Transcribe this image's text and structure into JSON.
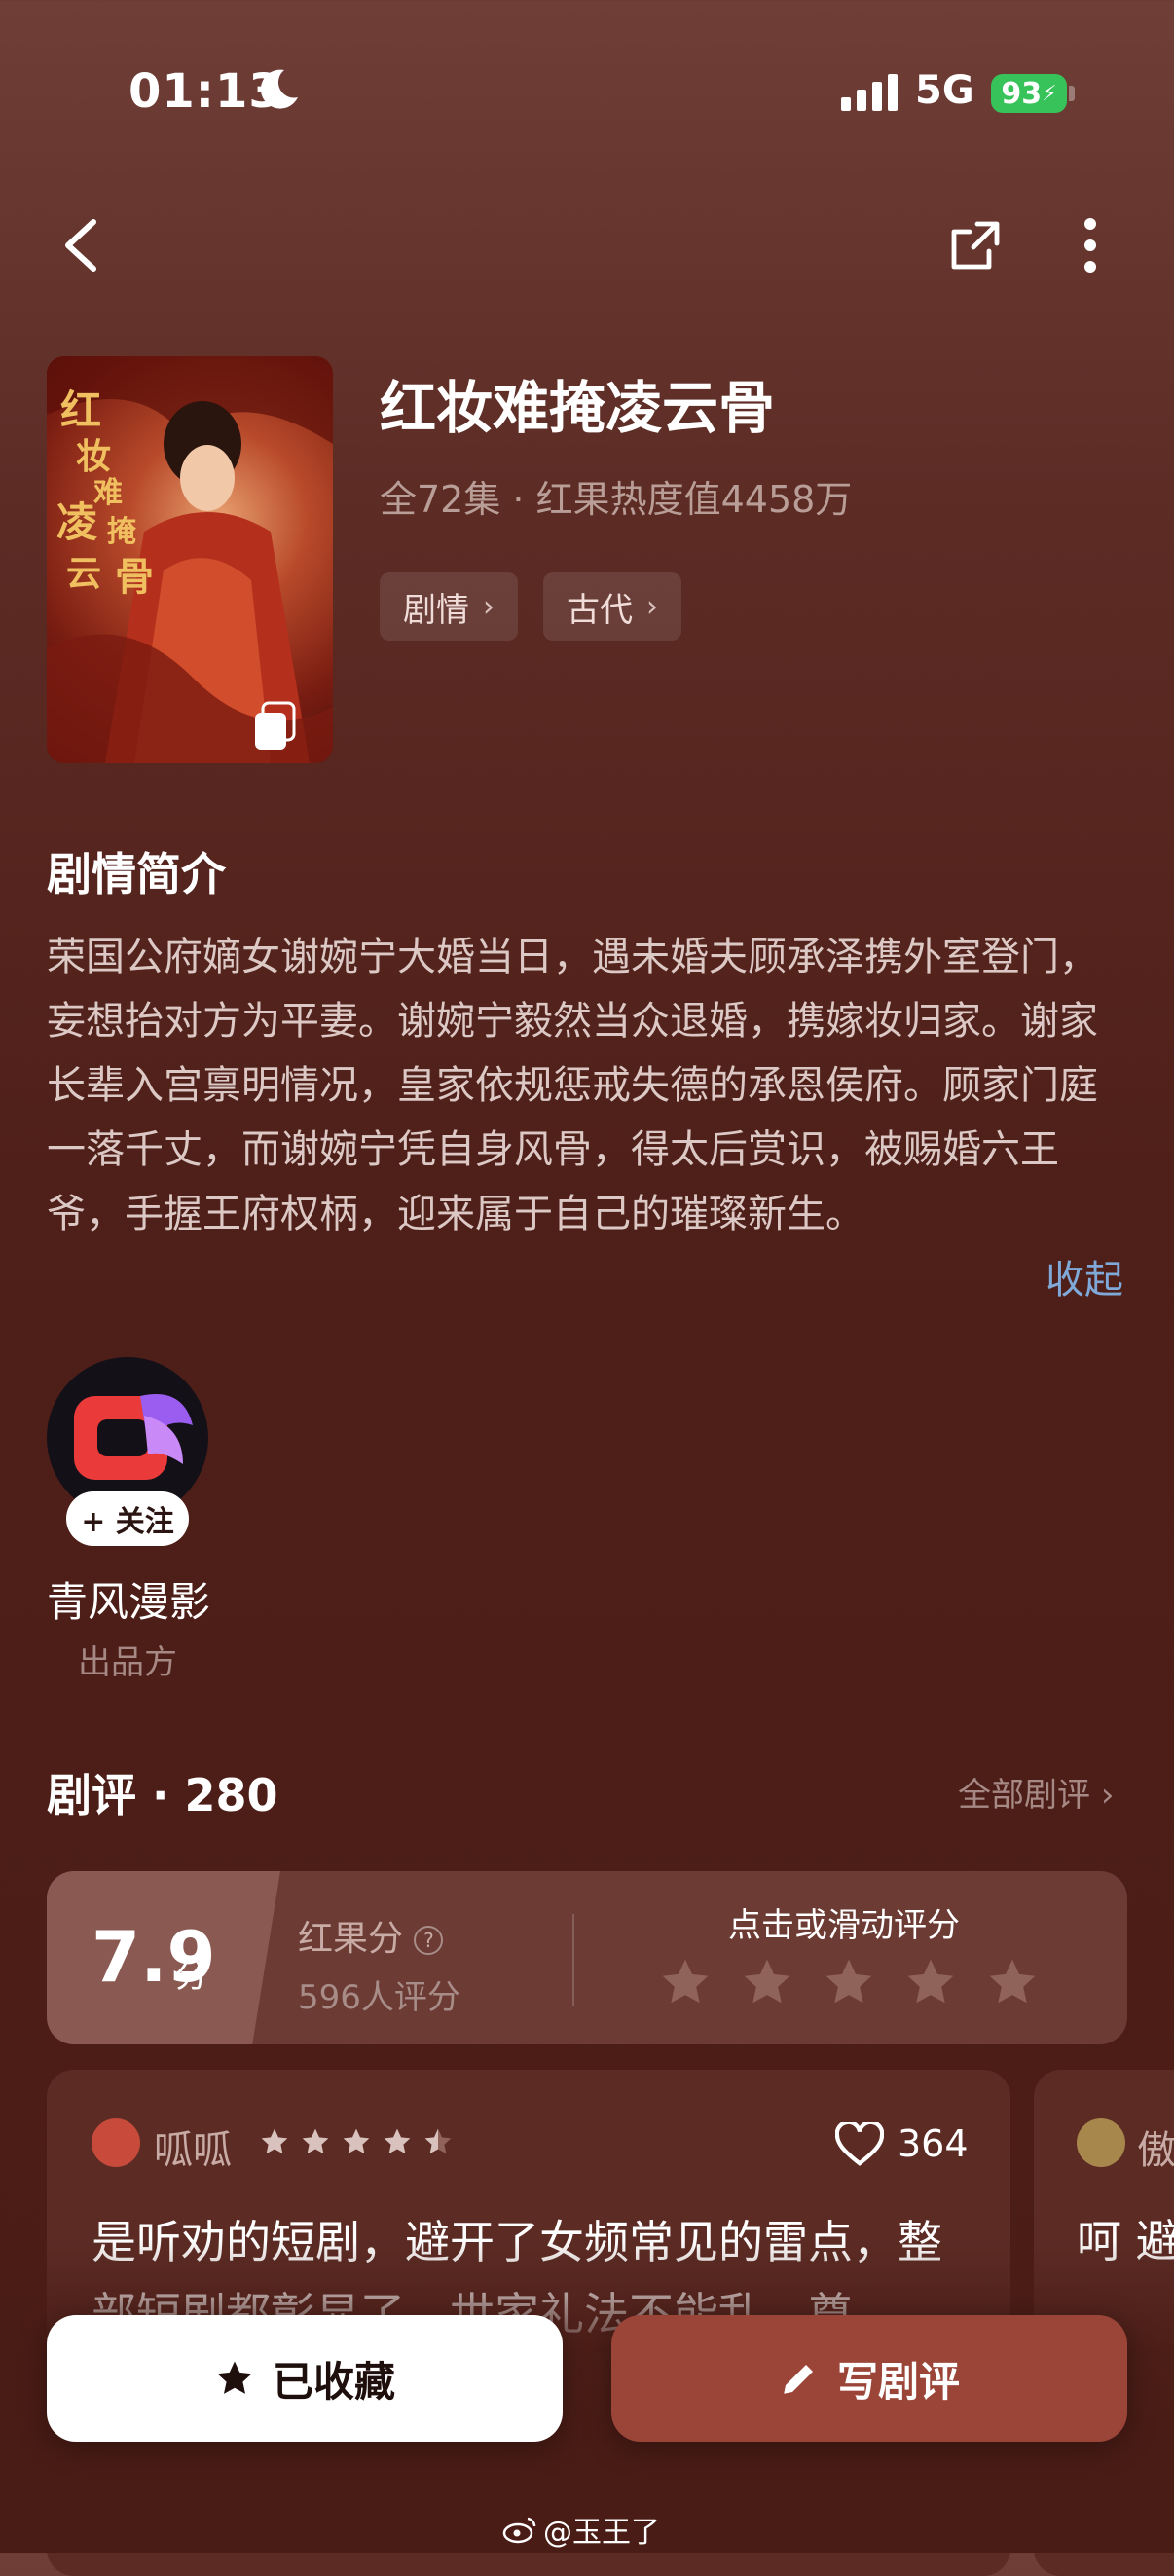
{
  "status": {
    "time": "01:13",
    "network": "5G",
    "battery": "93"
  },
  "drama": {
    "title": "红妆难掩凌云骨",
    "meta": "全72集 · 红果热度值4458万",
    "tags": [
      "剧情",
      "古代"
    ],
    "poster_title": "红妆难掩凌云骨"
  },
  "synopsis": {
    "heading": "剧情简介",
    "text": "荣国公府嫡女谢婉宁大婚当日，遇未婚夫顾承泽携外室登门，妄想抬对方为平妻。谢婉宁毅然当众退婚，携嫁妆归家。谢家长辈入宫禀明情况，皇家依规惩戒失德的承恩侯府。顾家门庭一落千丈，而谢婉宁凭自身风骨，得太后赏识，被赐婚六王爷，手握王府权柄，迎来属于自己的璀璨新生。",
    "collapse_label": "收起"
  },
  "publisher": {
    "name": "青风漫影",
    "role": "出品方",
    "follow_label": "+ 关注"
  },
  "reviews": {
    "heading": "剧评 · 280",
    "all_label": "全部剧评",
    "score": "7.9",
    "score_unit": "分",
    "score_label": "红果分",
    "rating_count": "596人评分",
    "rate_hint": "点击或滑动评分",
    "items": [
      {
        "user": "呱呱",
        "stars": 4.5,
        "likes": "364",
        "text": "是听劝的短剧，避开了女频常见的雷点，整部短剧都彰显了，世家礼法不能乱，尊"
      },
      {
        "user": "傲",
        "text": "呵 避"
      }
    ]
  },
  "actions": {
    "collect_label": "已收藏",
    "write_label": "写剧评"
  },
  "watermark": "@玉王了",
  "colors": {
    "accent_blue": "#7fa9d8",
    "write_button": "#9b4538",
    "battery_green": "#38c25a"
  }
}
